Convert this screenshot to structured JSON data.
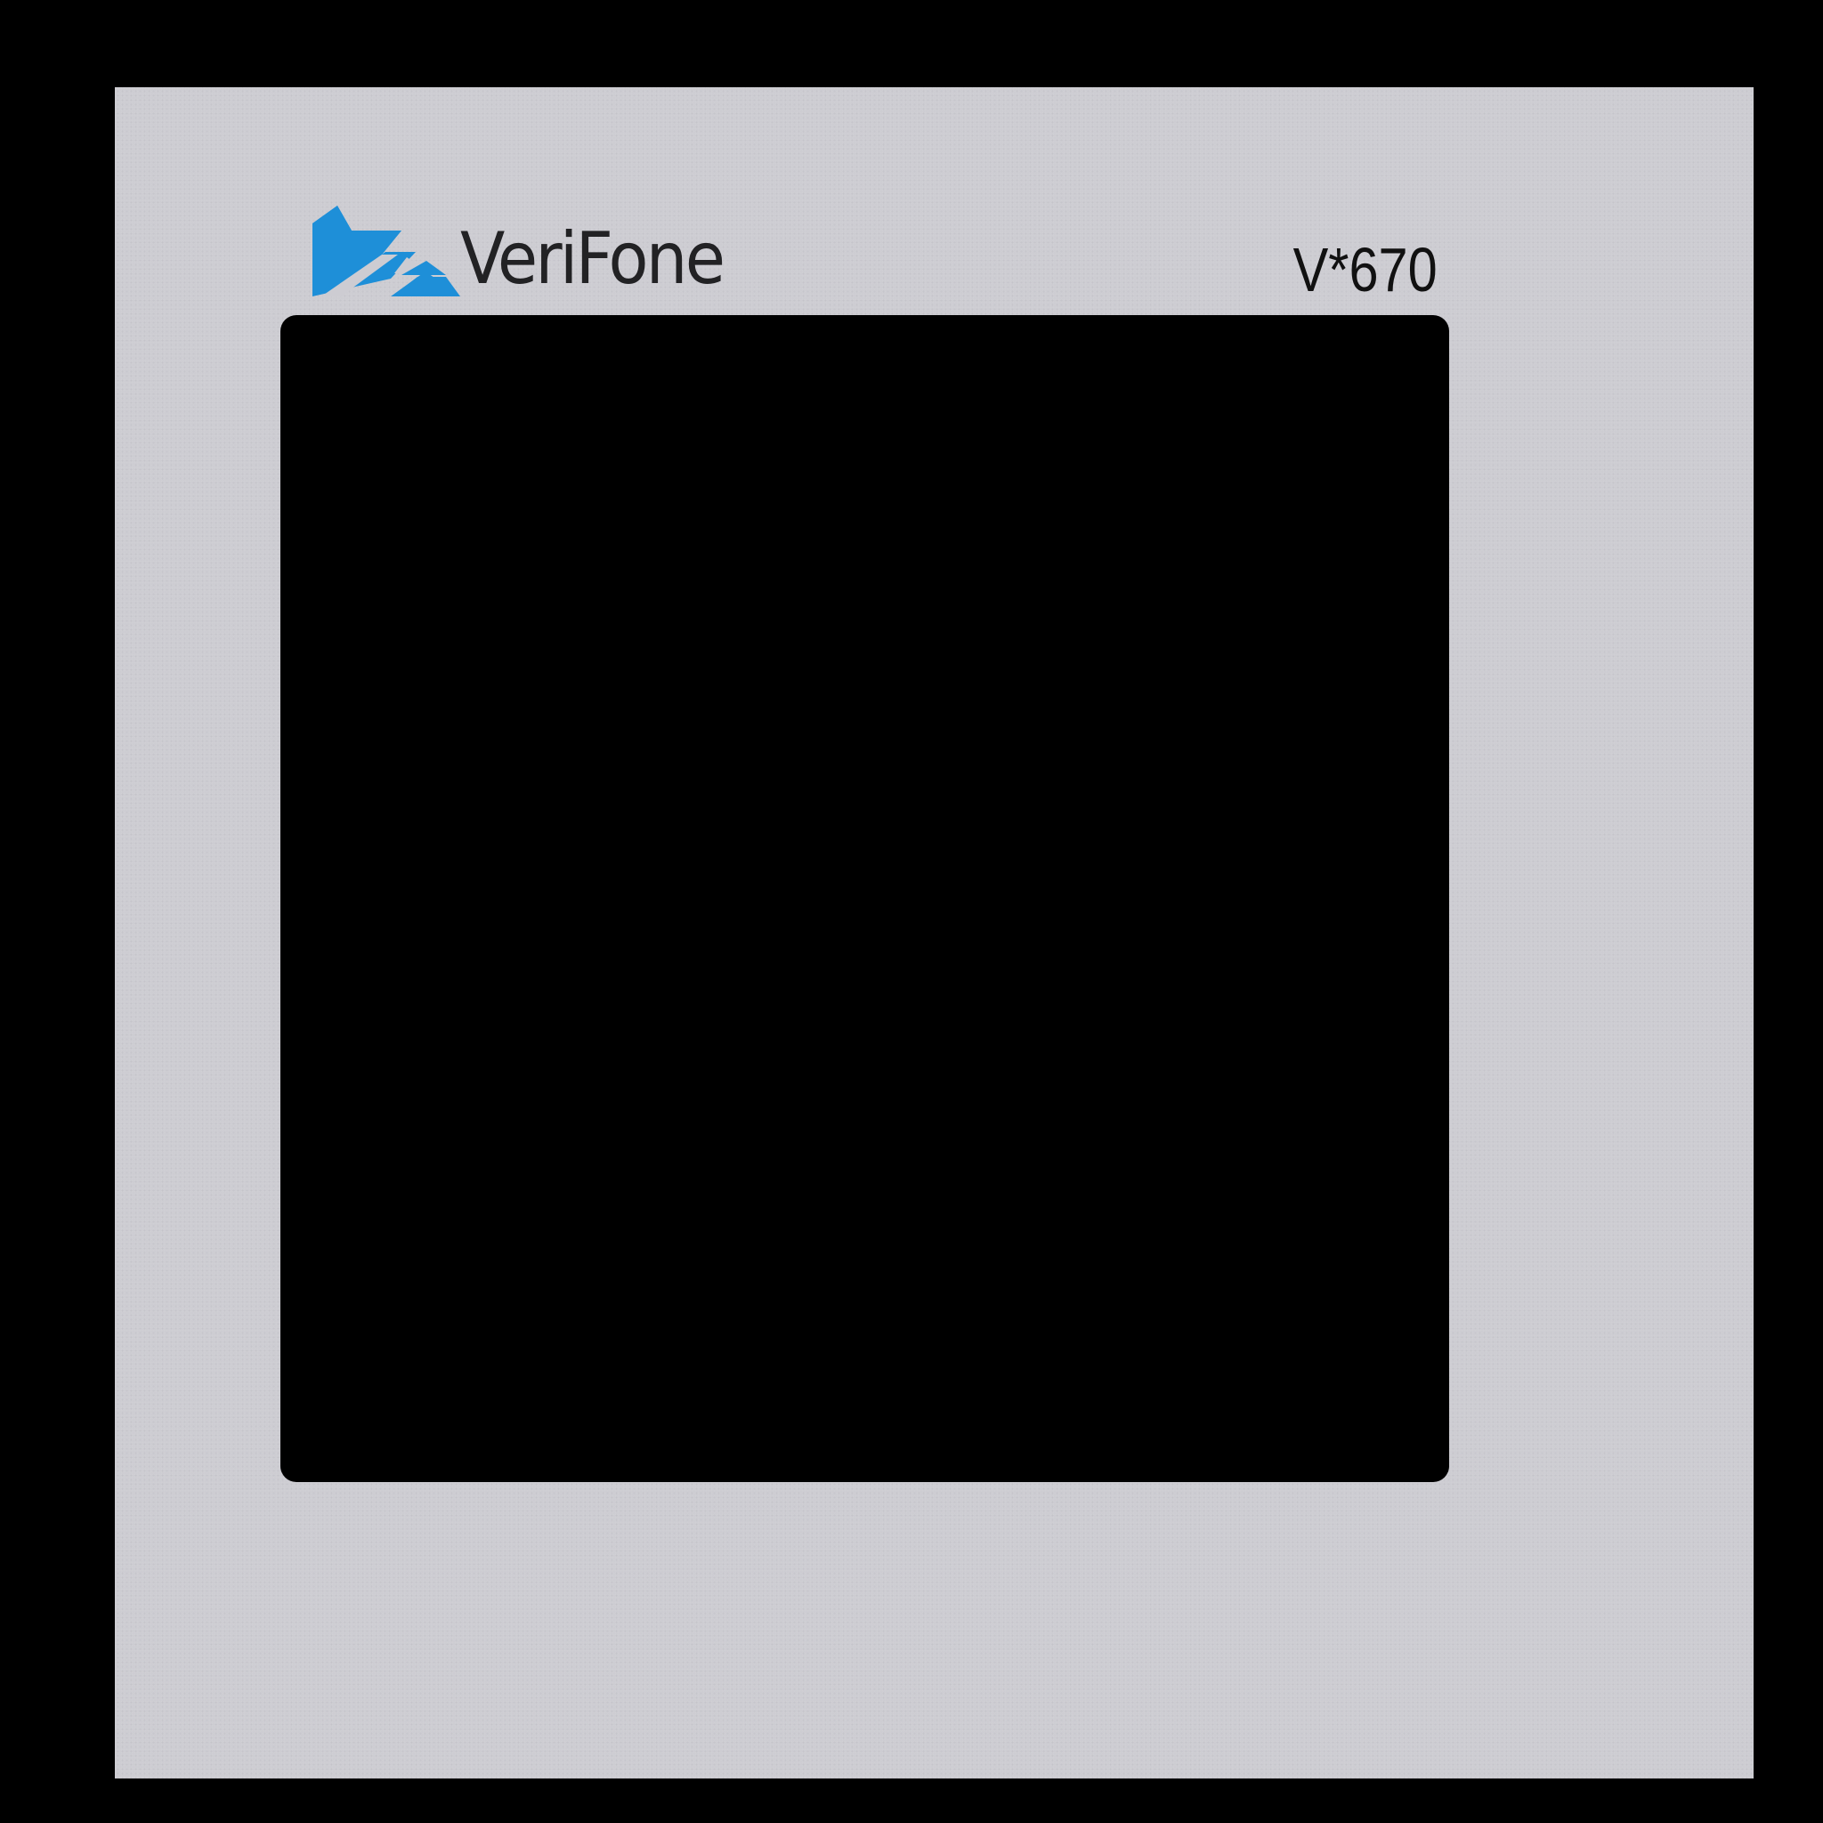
{
  "device": {
    "brand_name": "VeriFone",
    "model_label": "V*670"
  },
  "colors": {
    "brand_blue": "#1e8fd8",
    "panel_gray": "#cdccd2",
    "screen": "#000000",
    "text": "#222224"
  },
  "icons": {
    "logo_mark": "verifone-logo-icon"
  }
}
